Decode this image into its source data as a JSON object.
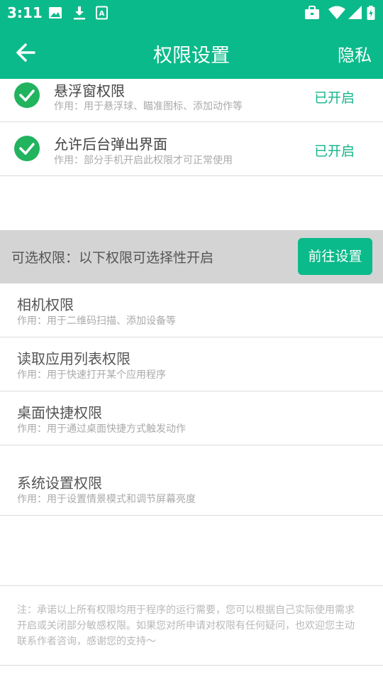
{
  "status_bar": {
    "time": "3:11",
    "icons": [
      "image-icon",
      "download-icon",
      "text-a-icon",
      "briefcase-icon",
      "wifi-icon",
      "signal-icon",
      "battery-charging-icon"
    ]
  },
  "app_bar": {
    "title": "权限设置",
    "privacy_label": "隐私",
    "back_icon": "arrow-left-icon"
  },
  "granted_permissions": [
    {
      "name": "悬浮窗权限",
      "desc": "作用：用于悬浮球、瞄准图标、添加动作等",
      "state": "已开启"
    },
    {
      "name": "允许后台弹出界面",
      "desc": "作用：部分手机开启此权限才可正常使用",
      "state": "已开启"
    }
  ],
  "optional_section": {
    "label": "可选权限：以下权限可选择性开启",
    "button_label": "前往设置"
  },
  "optional_permissions": [
    {
      "name": "相机权限",
      "desc": "作用：用于二维码扫描、添加设备等"
    },
    {
      "name": "读取应用列表权限",
      "desc": "作用：用于快速打开某个应用程序"
    },
    {
      "name": "桌面快捷权限",
      "desc": "作用：用于通过桌面快捷方式触发动作"
    },
    {
      "name": "系统设置权限",
      "desc": "作用：用于设置情景模式和调节屏幕亮度"
    }
  ],
  "note": "注：承诺以上所有权限均用于程序的运行需要，您可以根据自己实际使用需求开启或关闭部分敏感权限。如果您对所申请对权限有任何疑问，也欢迎您主动联系作者咨询，感谢您的支持～",
  "colors": {
    "accent": "#0bba8a",
    "check": "#22b35e",
    "enabled_text": "#14b48a",
    "section_bg": "#d4d4d4"
  }
}
